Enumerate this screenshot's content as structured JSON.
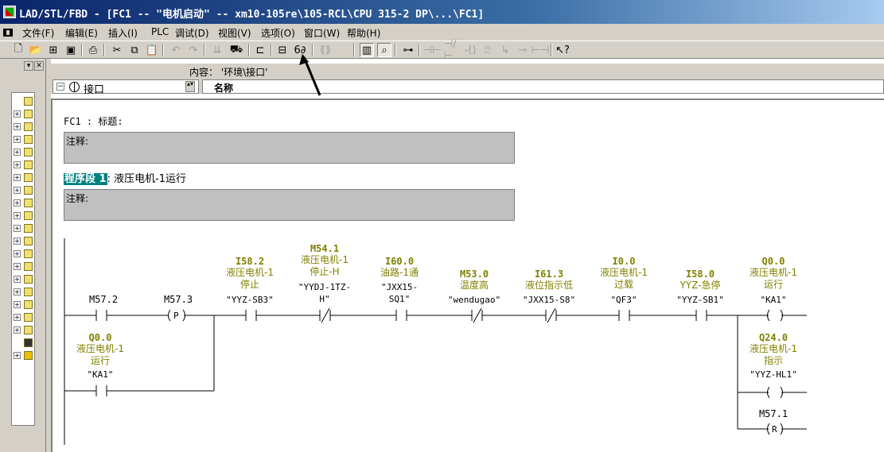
{
  "window": {
    "title": "LAD/STL/FBD  - [FC1 -- \"电机启动\" -- xm10-105re\\105-RCL\\CPU 315-2 DP\\...\\FC1]"
  },
  "menu": [
    "文件(F)",
    "编辑(E)",
    "插入(I)",
    "PLC",
    "调试(D)",
    "视图(V)",
    "选项(O)",
    "窗口(W)",
    "帮助(H)"
  ],
  "toolbar": {
    "icons": [
      "new-icon",
      "open-icon",
      "accessible-nodes-icon",
      "save-icon",
      "print-icon",
      "cut-icon",
      "copy-icon",
      "paste-icon",
      "undo-icon",
      "redo-icon",
      "download-icon",
      "upload-icon",
      "back-icon",
      "monitor-icon",
      "overview-icon",
      "network-icon",
      "tag-icon",
      "contact-no-icon",
      "contact-nc-icon",
      "coil-icon",
      "box-icon",
      "branch-open-icon",
      "branch-close-icon",
      "help-icon"
    ]
  },
  "interface": {
    "content_label": "内容： '环境\\接口'",
    "tree_root": "接口",
    "name_header": "名称"
  },
  "block": {
    "title": "FC1 : 标题:",
    "comment1": "注释:",
    "network_label": "程序段 1",
    "network_title": ": 液压电机-1运行",
    "comment2": "注释:"
  },
  "ladder": {
    "contacts": [
      {
        "addr": "M57.2",
        "symbol": "",
        "quoted": "",
        "type": "NO"
      },
      {
        "addr": "M57.3",
        "symbol": "",
        "quoted": "",
        "type": "P"
      },
      {
        "addr": "I58.2",
        "symbol": "液压电机-1\n停止",
        "quoted": "\"YYZ-SB3\"",
        "type": "NO"
      },
      {
        "addr": "M54.1",
        "symbol": "液压电机-1\n停止-H",
        "quoted": "\"YYDJ-1TZ-\nH\"",
        "type": "NC"
      },
      {
        "addr": "I60.0",
        "symbol": "油路-1通",
        "quoted": "\"JXX15-\nSQ1\"",
        "type": "NO"
      },
      {
        "addr": "M53.0",
        "symbol": "温度高",
        "quoted": "\"wendugao\"",
        "type": "NC"
      },
      {
        "addr": "I61.3",
        "symbol": "液位指示低",
        "quoted": "\"JXX15-S8\"",
        "type": "NC"
      },
      {
        "addr": "I0.0",
        "symbol": "液压电机-1\n过载",
        "quoted": "\"QF3\"",
        "type": "NO"
      },
      {
        "addr": "I58.0",
        "symbol": "YYZ-急停",
        "quoted": "\"YYZ-SB1\"",
        "type": "NO"
      }
    ],
    "coils": [
      {
        "addr": "Q0.0",
        "symbol": "液压电机-1\n运行",
        "quoted": "\"KA1\"",
        "type": "()"
      },
      {
        "addr": "Q24.0",
        "symbol": "液压电机-1\n指示",
        "quoted": "\"YYZ-HL1\"",
        "type": "()"
      },
      {
        "addr": "M57.1",
        "symbol": "",
        "quoted": "",
        "type": "(R)"
      }
    ],
    "parallel": {
      "addr": "Q0.0",
      "symbol": "液压电机-1\n运行",
      "quoted": "\"KA1\""
    },
    "labels": {
      "p_coil": "P",
      "r_coil": "R"
    }
  }
}
